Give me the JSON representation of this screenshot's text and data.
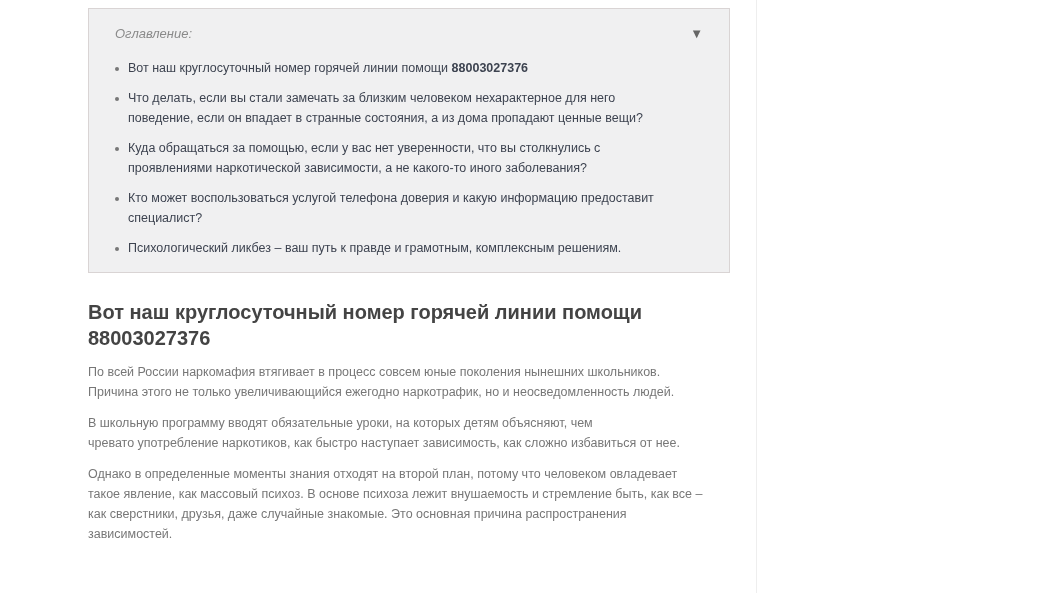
{
  "toc": {
    "title": "Оглавление:",
    "expanded": true,
    "toggle": "▼",
    "items": [
      {
        "text": "Вот наш круглосуточный номер горячей линии помощи **88003027376**"
      },
      {
        "text": "Что делать, если вы стали замечать за близким человеком нехарактерное для него\nповедение, если он впадает в странные состояния, а из дома пропадают ценные вещи?"
      },
      {
        "text": "Куда обращаться за помощью, если у вас нет уверенности, что вы столкнулись с\nпроявлениями наркотической зависимости, а не какого-то иного заболевания?"
      },
      {
        "text": "Кто может воспользоваться услугой телефона доверия и какую информацию предоставит\nспециалист?"
      },
      {
        "text": "Психологический ликбез – ваш путь к правде и грамотным, комплексным решениям."
      }
    ]
  },
  "heading": "Вот наш круглосуточный номер горячей линии помощи\n88003027376",
  "paragraphs": [
    "По всей России наркомафия втягивает в процесс совсем юные поколения нынешних школьников.\nПричина этого не только увеличивающийся ежегодно наркотрафик, но и неосведомленность людей.",
    "В школьную программу вводят обязательные уроки, на которых детям объясняют, чем\nчревато употребление наркотиков, как быстро наступает зависимость, как сложно избавиться от нее.",
    "Однако в определенные моменты знания отходят на второй план, потому что человеком овладевает\nтакое явление, как массовый психоз. В основе психоза лежит внушаемость и стремление быть, как все –\nкак сверстники, друзья, даже случайные знакомые. Это основная причина распространения\nзависимостей."
  ]
}
